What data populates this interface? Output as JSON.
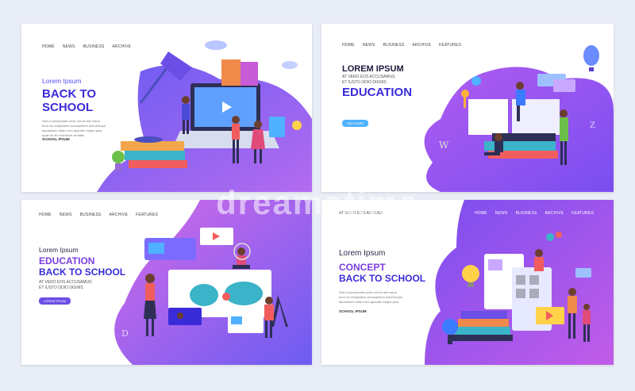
{
  "cards": [
    {
      "nav": [
        "HOME",
        "NEWS",
        "BUSINESS",
        "ARCHIVE"
      ],
      "eyebrow": "Lorem Ipsum",
      "title_line1": "BACK TO",
      "title_line2": "SCHOOL",
      "body_lines": [
        "Sed ut perspiciatis unde omnis iste natus",
        "error sit voluptatem accusantium doloremque",
        "laudantium totam rem aperiam eaque ipsa",
        "quae ab illo inventore veritatis"
      ],
      "link": "SCHOOL IPSUM"
    },
    {
      "nav": [
        "HOME",
        "NEWS",
        "BUSINESS",
        "ARCHIVE",
        "FEATURES"
      ],
      "eyebrow": "LOREM IPSUM",
      "sub_lines": [
        "AT VERO EOS ACCUSAMUS",
        "ET IUSTO ODIO DIGNIS"
      ],
      "title": "EDUCATION",
      "button": "SEE MORE"
    },
    {
      "nav": [
        "HOME",
        "NEWS",
        "BUSINESS",
        "ARCHIVE",
        "FEATURES"
      ],
      "eyebrow": "Lorem Ipsum",
      "title_line1": "EDUCATION",
      "title_line2": "BACK TO SCHOOL",
      "sub_lines": [
        "AT VERO EOS ACCUSAMUS",
        "ET IUSTO ODIO DIGNIS"
      ],
      "button": "LOREM IPSUM"
    },
    {
      "top_text": "AT VERO EOS ACCUSA",
      "nav": [
        "HOME",
        "NEWS",
        "BUSINESS",
        "ARCHIVE",
        "FEATURES"
      ],
      "eyebrow": "Lorem Ipsum",
      "title_line1": "CONCEPT",
      "title_line2": "BACK TO SCHOOL",
      "body_lines": [
        "Sed ut perspiciatis unde omnis iste natus",
        "error sit voluptatem accusantium doloremque",
        "laudantium totam rem aperiam eaque ipsa"
      ],
      "link": "SCHOOL IPSUM"
    }
  ],
  "watermark": "dreamstime",
  "colors": {
    "accent_purple": "#6b4ee6",
    "accent_blue": "#3a2bd8",
    "blob_violet": "#8f5cf0",
    "blob_pink": "#d16be8"
  }
}
